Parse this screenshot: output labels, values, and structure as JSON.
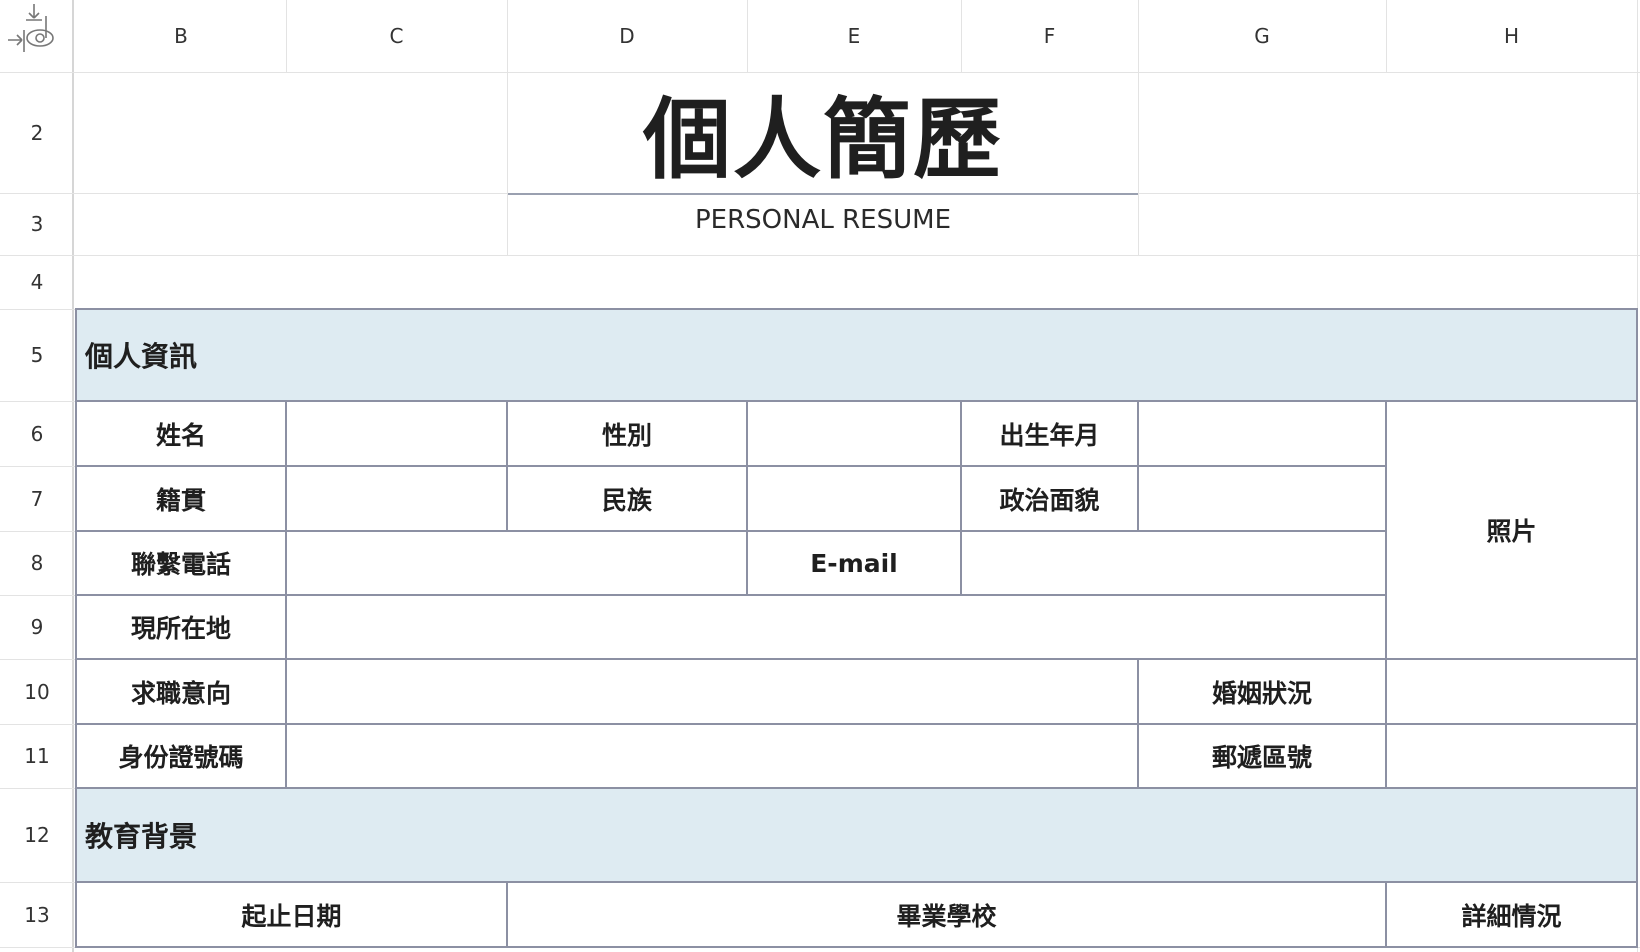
{
  "columns": [
    "B",
    "C",
    "D",
    "E",
    "F",
    "G",
    "H"
  ],
  "rows": [
    "2",
    "3",
    "4",
    "5",
    "6",
    "7",
    "8",
    "9",
    "10",
    "11",
    "12",
    "13"
  ],
  "title": "個人簡歷",
  "subtitle": "PERSONAL RESUME",
  "sections": {
    "personal": "個人資訊",
    "education": "教育背景"
  },
  "fields": {
    "name": "姓名",
    "gender": "性別",
    "birth": "出生年月",
    "native_place": "籍貫",
    "ethnicity": "民族",
    "political_status": "政治面貌",
    "phone": "聯繫電話",
    "email": "E-mail",
    "photo": "照片",
    "address": "現所在地",
    "job_intention": "求職意向",
    "marital_status": "婚姻狀況",
    "id_number": "身份證號碼",
    "postal_code": "郵遞區號"
  },
  "education_headers": {
    "dates": "起止日期",
    "school": "畢業學校",
    "details": "詳細情況"
  },
  "colors": {
    "section_band": "#deebf2",
    "table_border": "#8c90a3",
    "gridline": "#e3e3e3"
  }
}
